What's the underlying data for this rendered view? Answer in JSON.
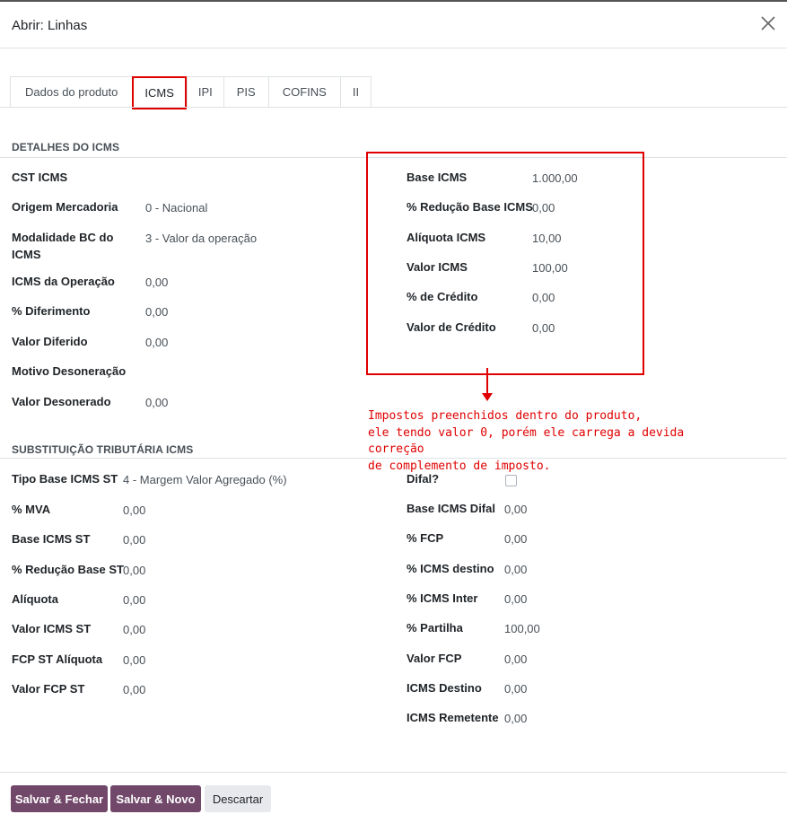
{
  "dialog": {
    "title": "Abrir: Linhas"
  },
  "tabs": [
    "Dados do produto",
    "ICMS",
    "IPI",
    "PIS",
    "COFINS",
    "II"
  ],
  "icms_details": {
    "heading": "DETALHES DO ICMS",
    "left": [
      {
        "label": "CST ICMS",
        "value": ""
      },
      {
        "label": "Origem Mercadoria",
        "value": "0 - Nacional"
      },
      {
        "label": "Modalidade BC do ICMS",
        "value": "3 - Valor da operação"
      },
      {
        "label": "ICMS da Operação",
        "value": "0,00"
      },
      {
        "label": "% Diferimento",
        "value": "0,00"
      },
      {
        "label": "Valor Diferido",
        "value": "0,00"
      },
      {
        "label": "Motivo Desoneração",
        "value": ""
      },
      {
        "label": "Valor Desonerado",
        "value": "0,00"
      }
    ],
    "right": [
      {
        "label": "Base ICMS",
        "value": "1.000,00"
      },
      {
        "label": "% Redução Base ICMS",
        "value": "0,00"
      },
      {
        "label": "Alíquota ICMS",
        "value": "10,00"
      },
      {
        "label": "Valor ICMS",
        "value": "100,00"
      },
      {
        "label": "% de Crédito",
        "value": "0,00"
      },
      {
        "label": "Valor de Crédito",
        "value": "0,00"
      }
    ]
  },
  "annotation": "Impostos preenchidos dentro do produto,\nele tendo valor 0, porém ele carrega a devida correção\nde complemento de imposto.",
  "icms_st": {
    "heading": "SUBSTITUIÇÃO TRIBUTÁRIA ICMS",
    "left": [
      {
        "label": "Tipo Base ICMS ST",
        "value": "4 - Margem Valor Agregado (%)"
      },
      {
        "label": "% MVA",
        "value": "0,00"
      },
      {
        "label": "Base ICMS ST",
        "value": "0,00"
      },
      {
        "label": "% Redução Base ST",
        "value": "0,00"
      },
      {
        "label": "Alíquota",
        "value": "0,00"
      },
      {
        "label": "Valor ICMS ST",
        "value": "0,00"
      },
      {
        "label": "FCP ST Alíquota",
        "value": "0,00"
      },
      {
        "label": "Valor FCP ST",
        "value": "0,00"
      }
    ],
    "right": [
      {
        "label": "Difal?",
        "value": ""
      },
      {
        "label": "Base ICMS Difal",
        "value": "0,00"
      },
      {
        "label": "% FCP",
        "value": "0,00"
      },
      {
        "label": "% ICMS destino",
        "value": "0,00"
      },
      {
        "label": "% ICMS Inter",
        "value": "0,00"
      },
      {
        "label": "% Partilha",
        "value": "100,00"
      },
      {
        "label": "Valor FCP",
        "value": "0,00"
      },
      {
        "label": "ICMS Destino",
        "value": "0,00"
      },
      {
        "label": "ICMS Remetente",
        "value": "0,00"
      }
    ]
  },
  "footer": {
    "save_close": "Salvar & Fechar",
    "save_new": "Salvar & Novo",
    "discard": "Descartar"
  },
  "colors": {
    "primary": "#71486a",
    "annotation": "#e00000"
  }
}
